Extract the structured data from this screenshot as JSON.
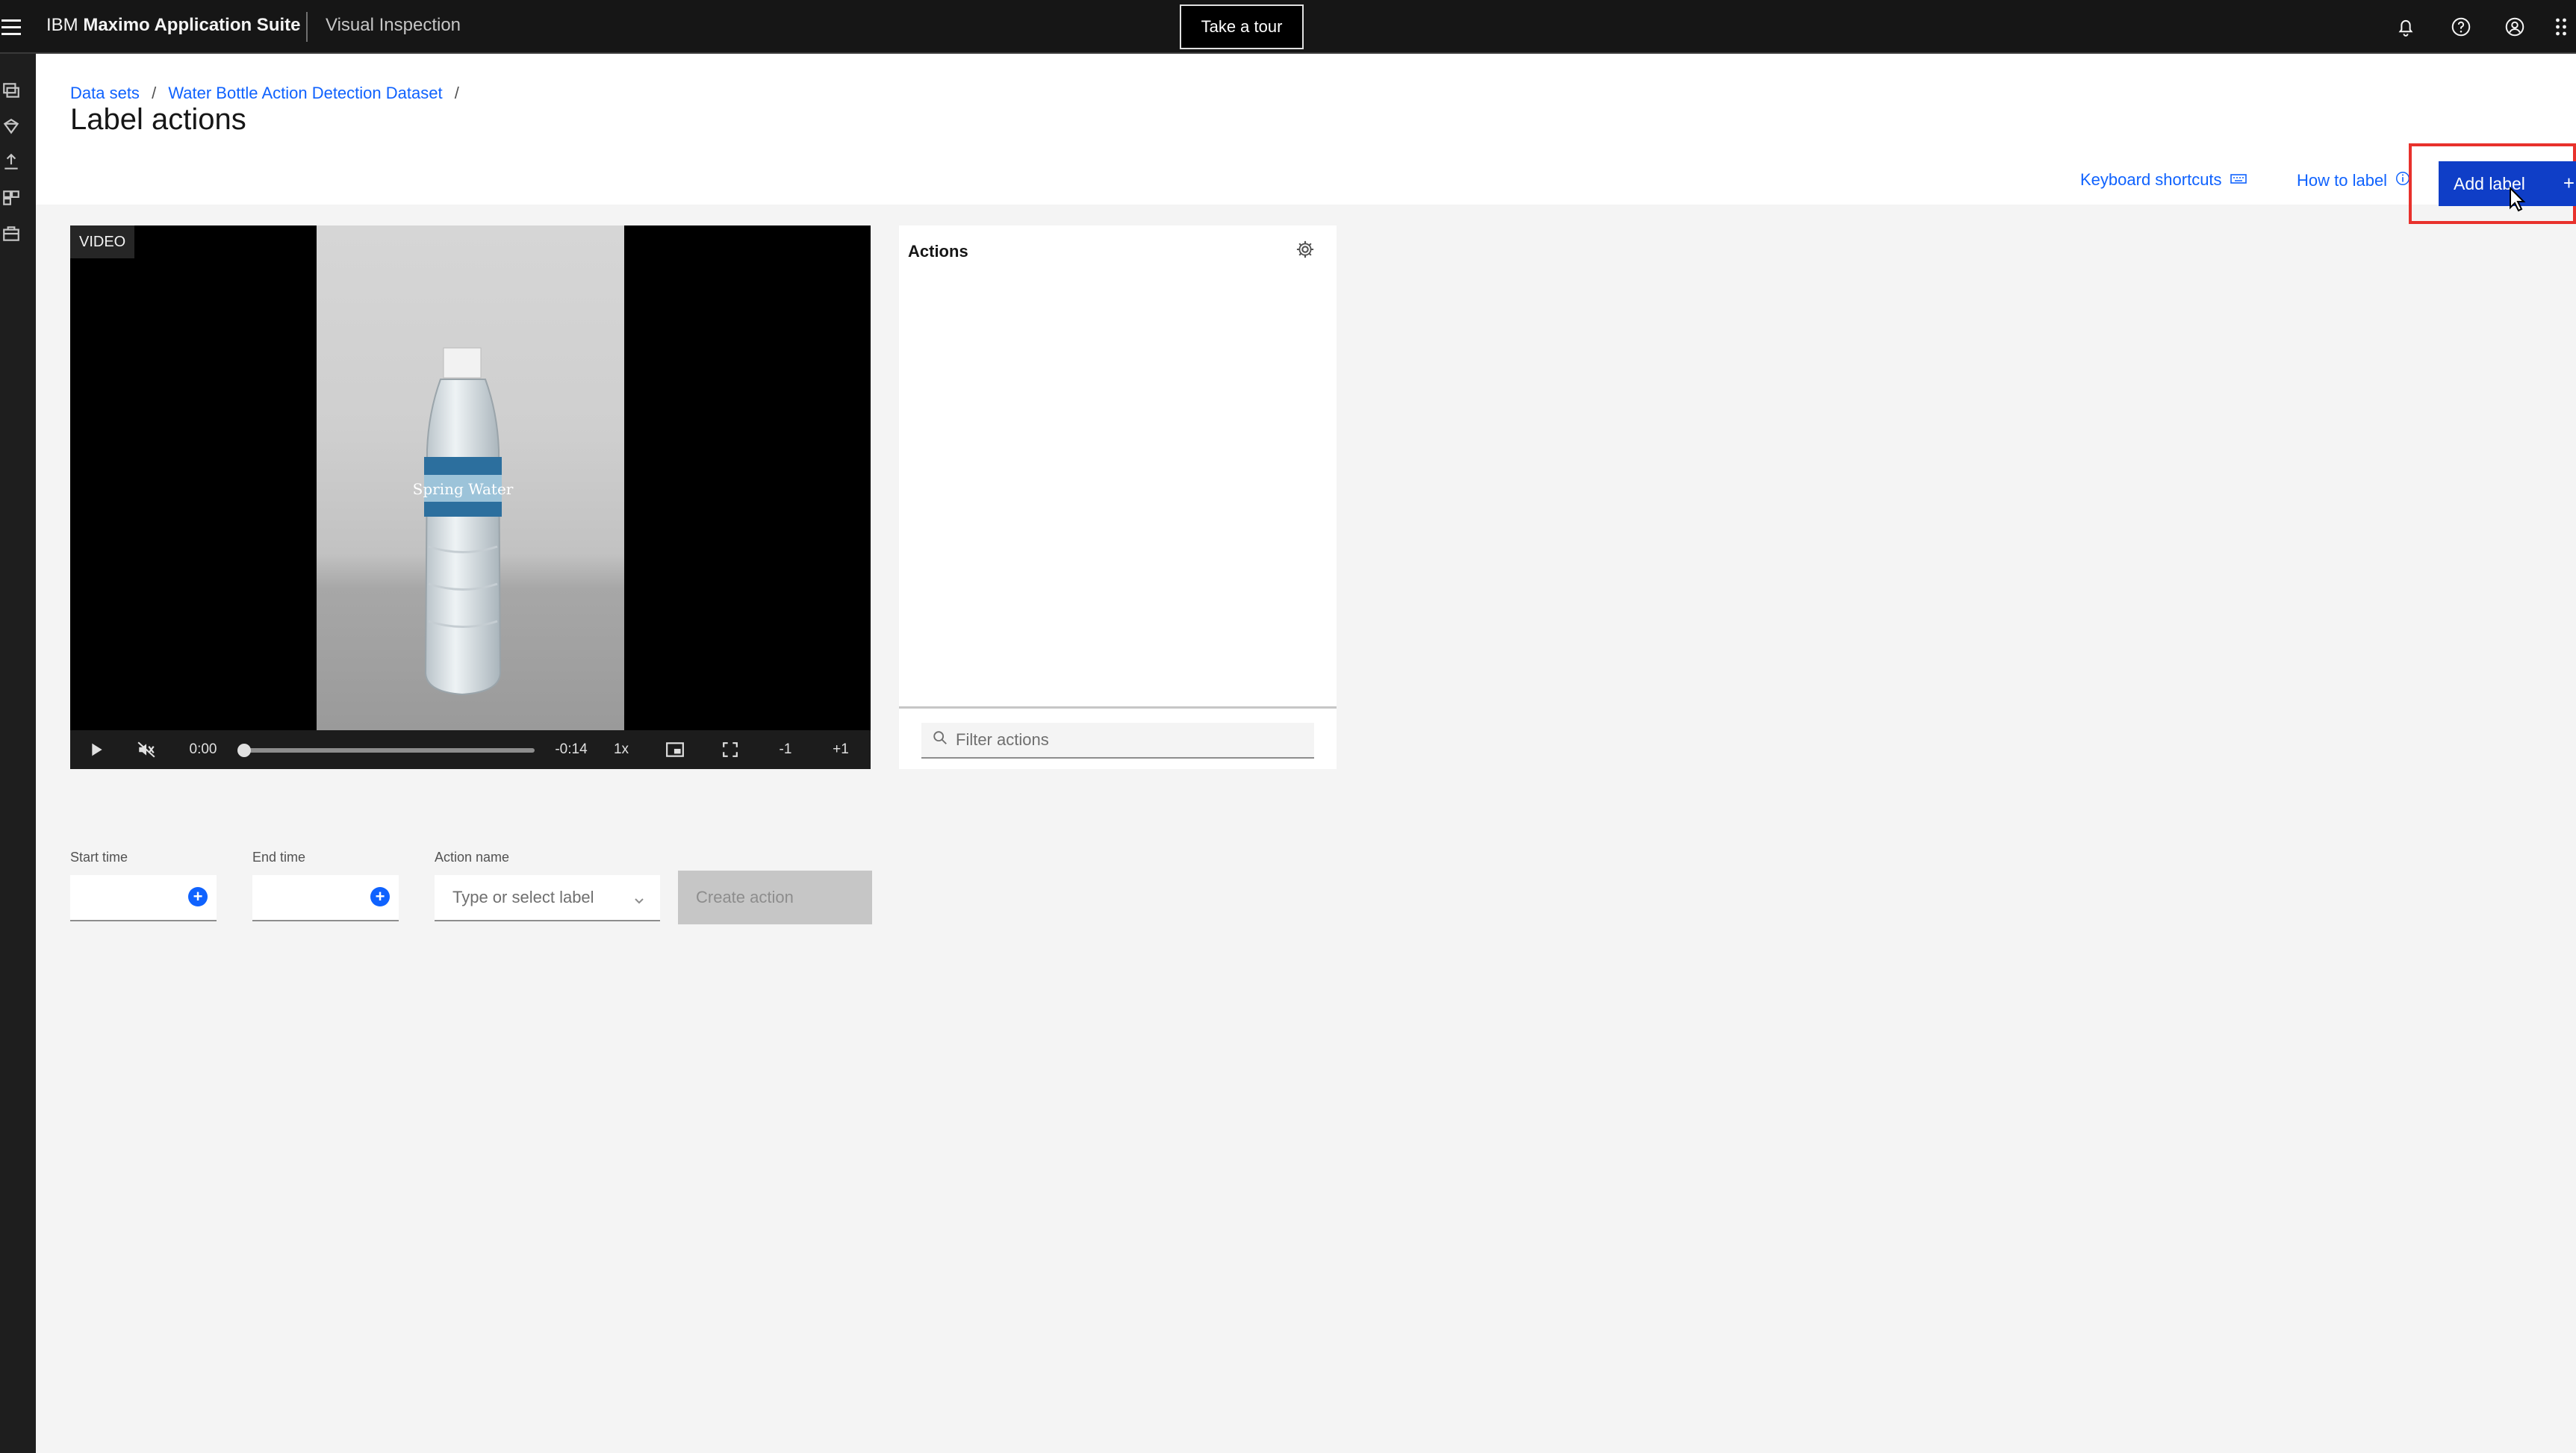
{
  "topbar": {
    "brand_prefix": "IBM",
    "brand_name": "Maximo Application Suite",
    "product": "Visual Inspection",
    "tour_label": "Take a tour",
    "icons": [
      "hamburger-icon",
      "notification-icon",
      "help-icon",
      "user-icon",
      "app-switcher-icon"
    ]
  },
  "sidenav": {
    "icons": [
      "datasets-icon",
      "models-icon",
      "deploy-icon",
      "projects-icon",
      "inventory-icon"
    ]
  },
  "breadcrumb": {
    "items": [
      "Data sets",
      "Water Bottle Action Detection Dataset"
    ],
    "separator": "/"
  },
  "page": {
    "title": "Label actions"
  },
  "toolbar": {
    "keyboard_shortcuts": "Keyboard shortcuts",
    "how_to_label": "How to label",
    "add_label": "Add label",
    "add_plus": "+"
  },
  "video": {
    "tag": "VIDEO",
    "current_time": "0:00",
    "remaining_time": "-0:14",
    "speed": "1x",
    "step_back": "-1",
    "step_forward": "+1",
    "progress": 0,
    "label_text": "Spring Water"
  },
  "actions_panel": {
    "title": "Actions",
    "filter_placeholder": "Filter actions"
  },
  "form": {
    "start_time_label": "Start time",
    "end_time_label": "End time",
    "action_name_label": "Action name",
    "action_name_placeholder": "Type or select label",
    "create_button": "Create action"
  },
  "colors": {
    "topbar_bg": "#161616",
    "link_blue": "#0f62fe",
    "primary_button": "#0f3ec7",
    "highlight_box": "#e8312c",
    "disabled_button": "#c6c6c6"
  }
}
